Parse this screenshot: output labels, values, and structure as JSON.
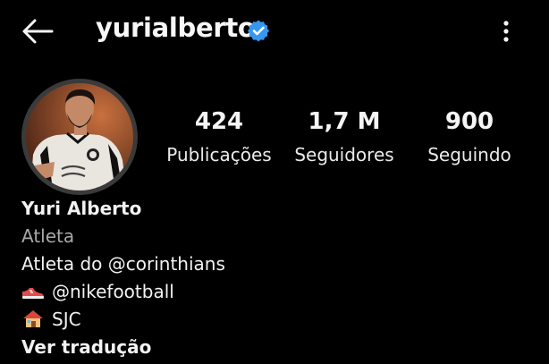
{
  "header": {
    "username": "yurialberto",
    "verified_color": "#3797f0",
    "back_icon": "arrow-left-icon",
    "more_icon": "more-vertical-icon"
  },
  "stats": [
    {
      "value": "424",
      "label": "Publicações"
    },
    {
      "value": "1,7 M",
      "label": "Seguidores"
    },
    {
      "value": "900",
      "label": "Seguindo"
    }
  ],
  "bio": {
    "name": "Yuri Alberto",
    "category": "Atleta",
    "line1": "Atleta do @corinthians",
    "line2": "@nikefootball",
    "line2_icon": "sneaker-emoji",
    "line3": "SJC",
    "line3_icon": "house-emoji",
    "translate": "Ver tradução"
  }
}
